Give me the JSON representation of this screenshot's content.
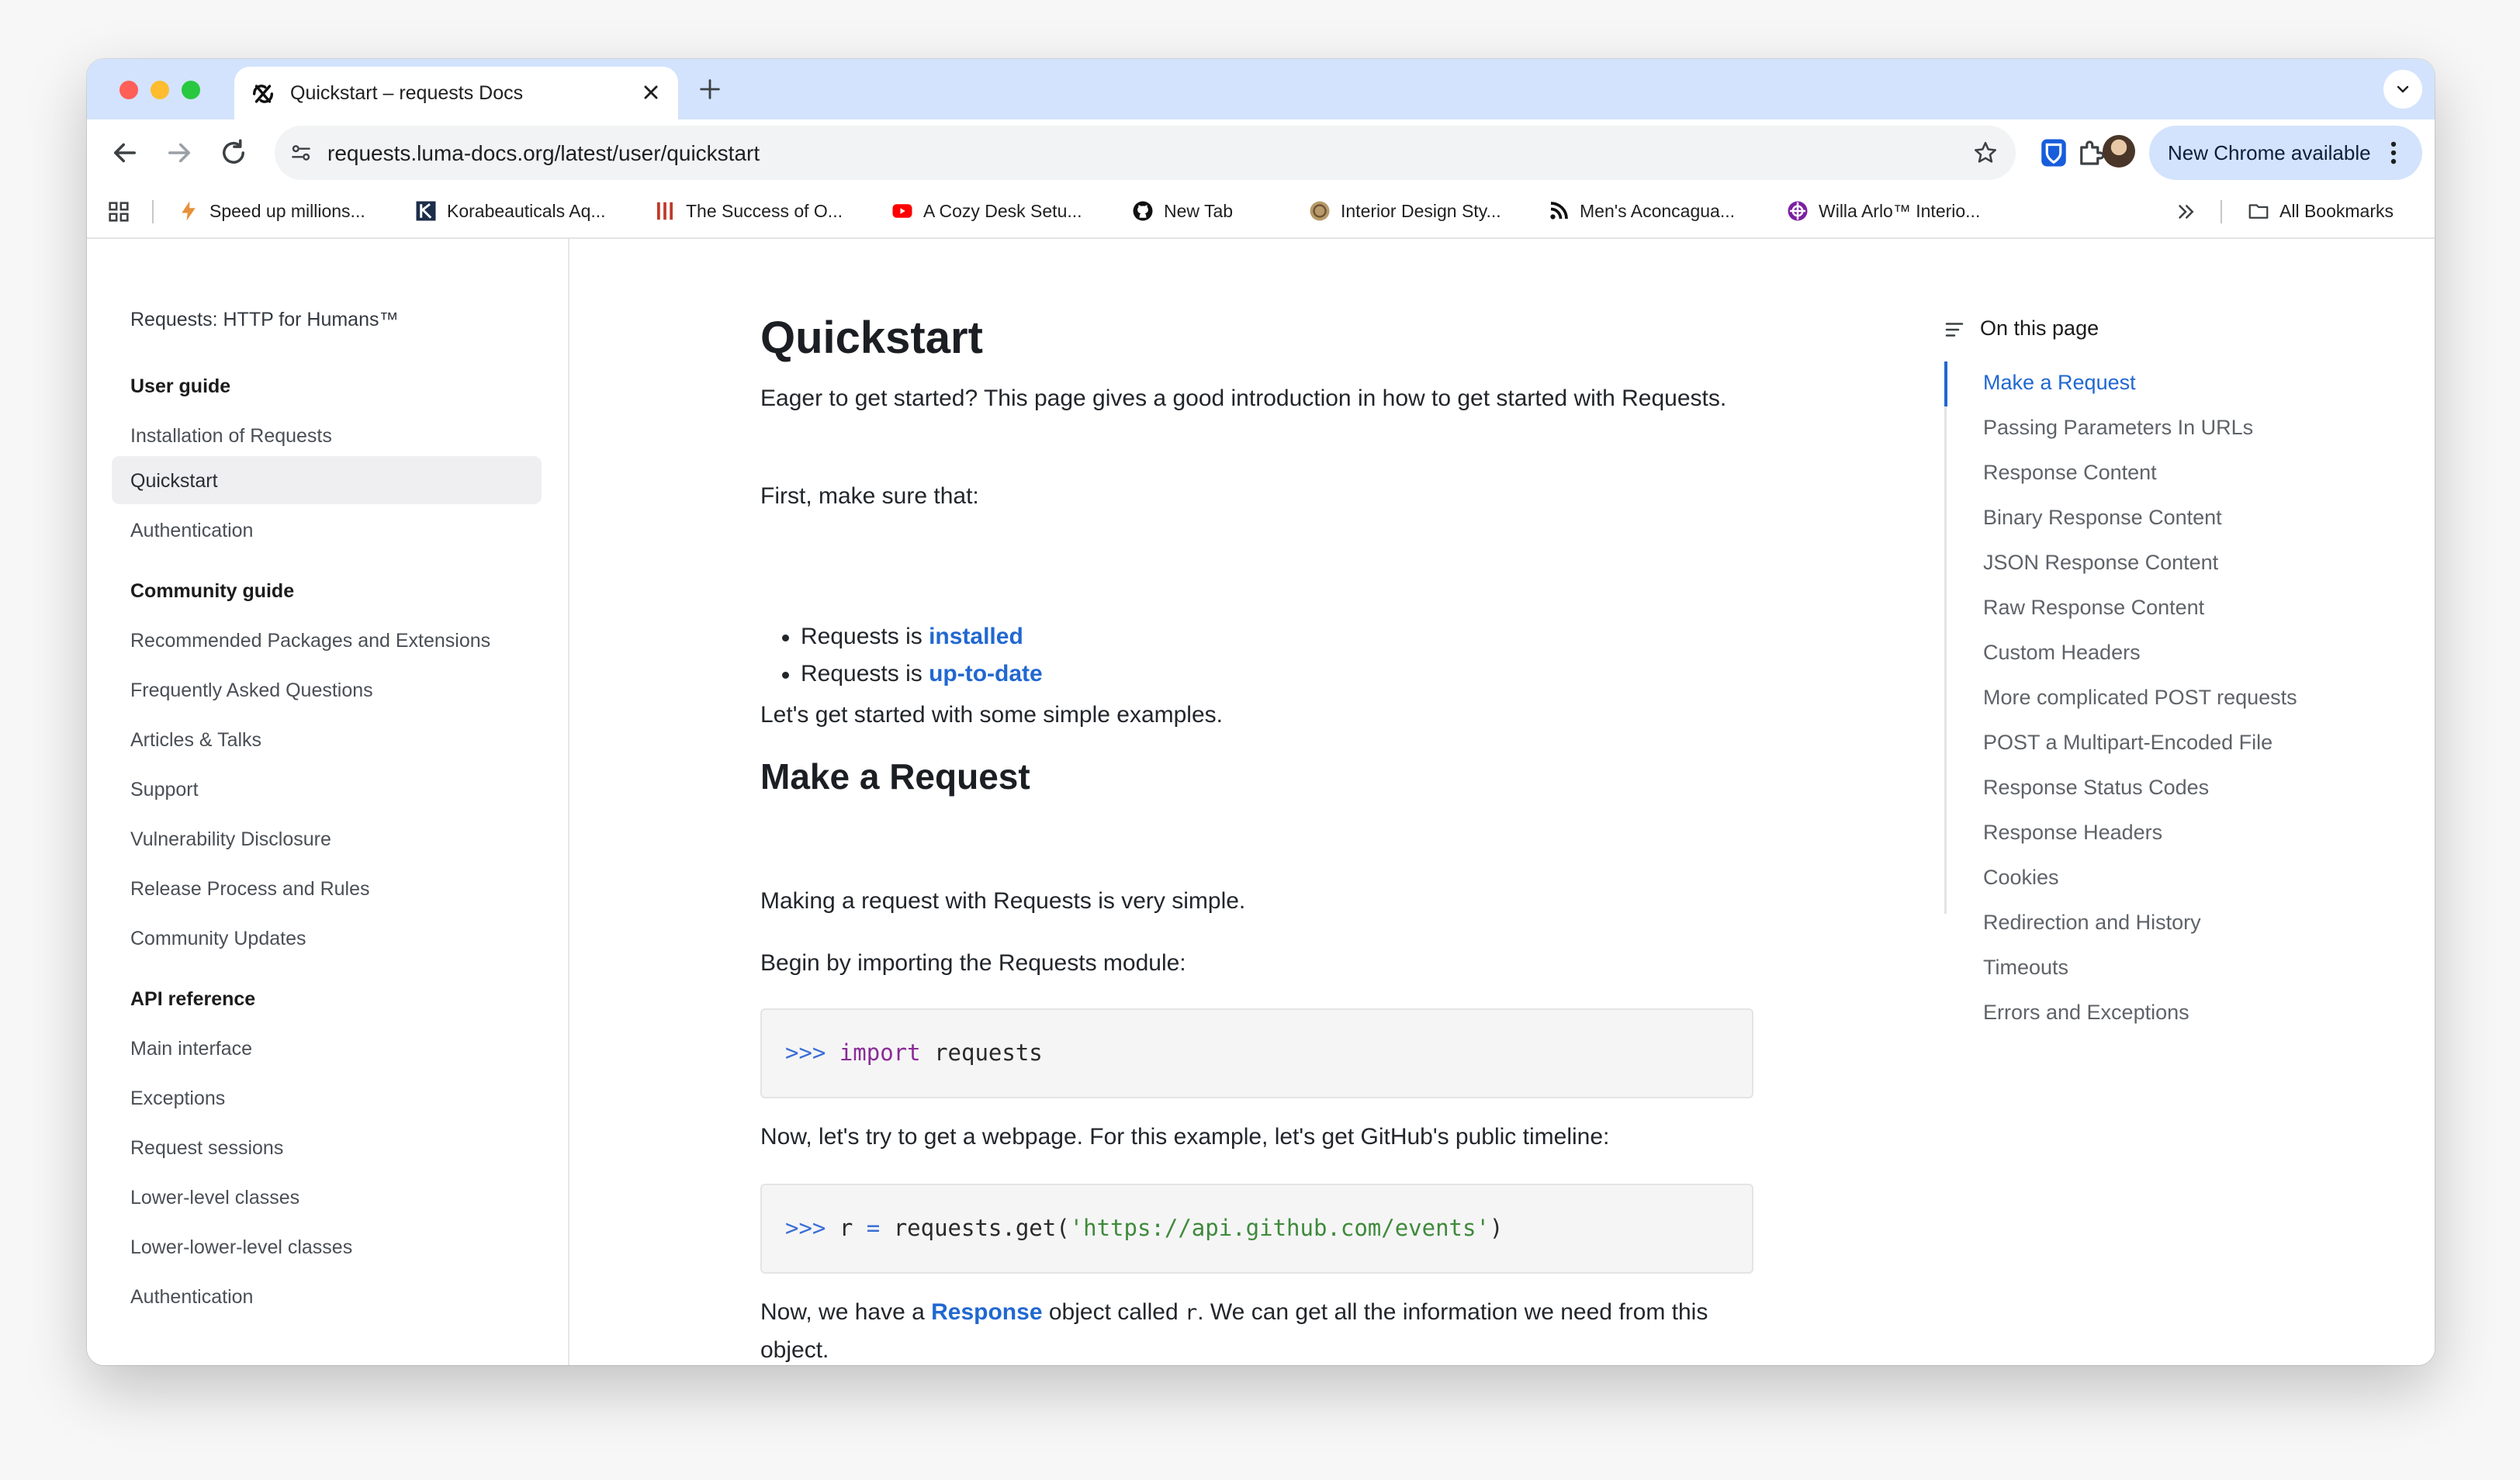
{
  "browser": {
    "tab_title": "Quickstart – requests Docs",
    "url": "requests.luma-docs.org/latest/user/quickstart",
    "update_label": "New Chrome available",
    "bookmarks": [
      {
        "label": "Speed up millions...",
        "icon": "lightning-icon"
      },
      {
        "label": "Korabeauticals Aq...",
        "icon": "k-logo-icon"
      },
      {
        "label": "The Success of O...",
        "icon": "bars-logo-icon"
      },
      {
        "label": "A Cozy Desk Setu...",
        "icon": "youtube-icon"
      },
      {
        "label": "New Tab",
        "icon": "github-icon"
      },
      {
        "label": "Interior Design Sty...",
        "icon": "round-logo-icon"
      },
      {
        "label": "Men's Aconcagua...",
        "icon": "rss-icon"
      },
      {
        "label": "Willa Arlo™ Interio...",
        "icon": "globe-logo-icon"
      }
    ],
    "all_bookmarks_label": "All Bookmarks"
  },
  "sidebar": {
    "brand": "Requests: HTTP for Humans™",
    "sections": [
      {
        "heading": "User guide",
        "items": [
          "Installation of Requests",
          "Quickstart",
          "Authentication"
        ]
      },
      {
        "heading": "Community guide",
        "items": [
          "Recommended Packages and Extensions",
          "Frequently Asked Questions",
          "Articles & Talks",
          "Support",
          "Vulnerability Disclosure",
          "Release Process and Rules",
          "Community Updates"
        ]
      },
      {
        "heading": "API reference",
        "items": [
          "Main interface",
          "Exceptions",
          "Request sessions",
          "Lower-level classes",
          "Lower-lower-level classes",
          "Authentication"
        ]
      }
    ],
    "active_item": "Quickstart"
  },
  "main": {
    "title": "Quickstart",
    "intro": "Eager to get started? This page gives a good introduction in how to get started with Requests.",
    "first": "First, make sure that:",
    "bullets": [
      {
        "prefix": "Requests is ",
        "link": "installed"
      },
      {
        "prefix": "Requests is ",
        "link": "up-to-date"
      }
    ],
    "simple_examples": "Let's get started with some simple examples.",
    "section_title": "Make a Request",
    "making_simple": "Making a request with Requests is very simple.",
    "begin_import": "Begin by importing the Requests module:",
    "code1": {
      "prompt": ">>> ",
      "keyword": "import",
      "rest": " requests"
    },
    "now_webpage": "Now, let's try to get a webpage. For this example, let's get GitHub's public timeline:",
    "code2": {
      "prompt": ">>> ",
      "var": "r ",
      "op": "=",
      "call": " requests.get(",
      "string": "'https://api.github.com/events'",
      "close": ")"
    },
    "response_para": {
      "before": "Now, we have a ",
      "link": "Response",
      "middle": " object called ",
      "code": "r",
      "after": ". We can get all the information we need from this object."
    }
  },
  "toc": {
    "title": "On this page",
    "items": [
      "Make a Request",
      "Passing Parameters In URLs",
      "Response Content",
      "Binary Response Content",
      "JSON Response Content",
      "Raw Response Content",
      "Custom Headers",
      "More complicated POST requests",
      "POST a Multipart-Encoded File",
      "Response Status Codes",
      "Response Headers",
      "Cookies",
      "Redirection and History",
      "Timeouts",
      "Errors and Exceptions"
    ],
    "active_item": "Make a Request"
  },
  "colors": {
    "accent": "#2168d1",
    "tabstrip": "#d3e3fd"
  }
}
